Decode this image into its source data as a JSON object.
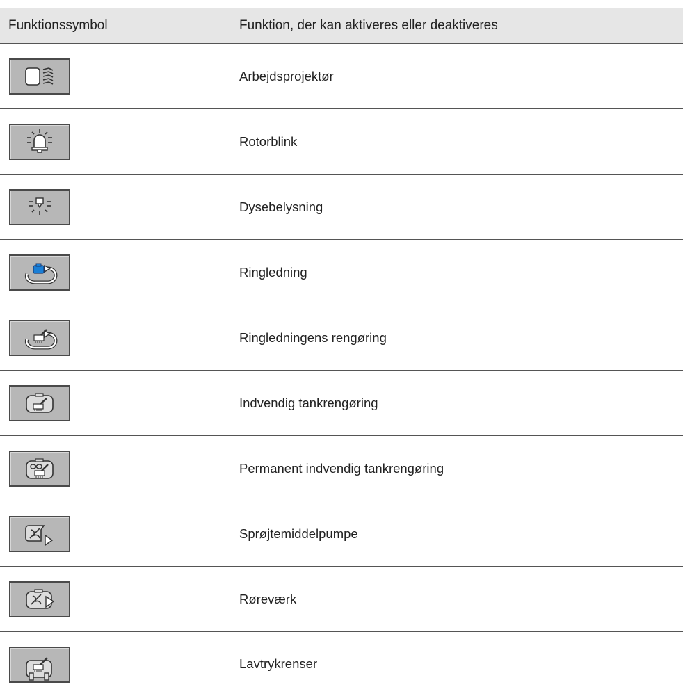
{
  "table": {
    "header": {
      "col1": "Funktionssymbol",
      "col2": "Funktion, der kan aktiveres eller deaktiveres"
    },
    "rows": [
      {
        "icon": "work-light-icon",
        "label": "Arbejdsprojektør"
      },
      {
        "icon": "rotating-beacon-icon",
        "label": "Rotorblink"
      },
      {
        "icon": "nozzle-lighting-icon",
        "label": "Dysebelysning"
      },
      {
        "icon": "circulation-line-icon",
        "label": "Ringledning"
      },
      {
        "icon": "circulation-line-cleaning-icon",
        "label": "Ringledningens rengøring"
      },
      {
        "icon": "tank-interior-cleaning-icon",
        "label": "Indvendig tankrengøring"
      },
      {
        "icon": "permanent-tank-cleaning-icon",
        "label": "Permanent indvendig tankrengøring"
      },
      {
        "icon": "sprayer-pump-icon",
        "label": "Sprøjtemiddelpumpe"
      },
      {
        "icon": "agitator-icon",
        "label": "Røreværk"
      },
      {
        "icon": "low-pressure-cleaner-icon",
        "label": "Lavtrykrenser"
      }
    ]
  }
}
